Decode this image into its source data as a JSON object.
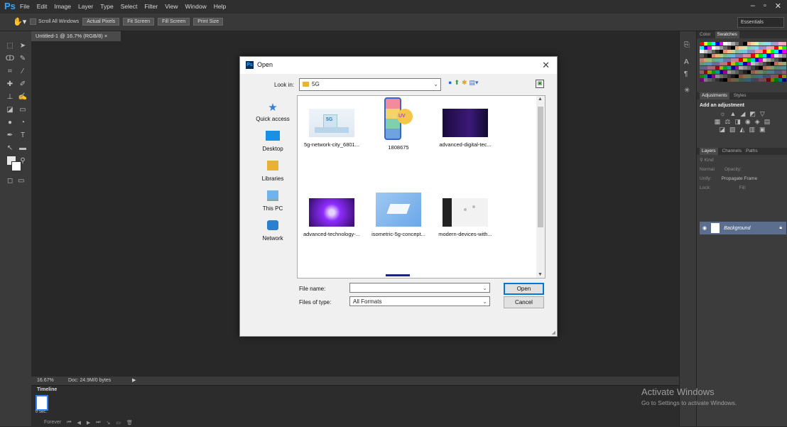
{
  "app": {
    "logo": "Ps",
    "menu": [
      "File",
      "Edit",
      "Image",
      "Layer",
      "Type",
      "Select",
      "Filter",
      "View",
      "Window",
      "Help"
    ],
    "window_controls": [
      "–",
      "▫",
      "✕"
    ]
  },
  "options_bar": {
    "tool_icon": "hand-tool-icon",
    "scroll_all_label": "Scroll All Windows",
    "buttons": [
      "Actual Pixels",
      "Fit Screen",
      "Fill Screen",
      "Print Size"
    ],
    "workspace": "Essentials"
  },
  "document": {
    "tab": "Untitled-1 @ 16.7% (RGB/8)  ×",
    "zoom": "16.67%",
    "doc_info": "Doc: 24.9M/0 bytes"
  },
  "timeline": {
    "title": "Timeline",
    "frame_time": "0 sec.",
    "loop": "Forever"
  },
  "panels": {
    "color_tabs": [
      "Color",
      "Swatches"
    ],
    "adjust_tabs": [
      "Adjustments",
      "Styles"
    ],
    "add_adjustment": "Add an adjustment",
    "layer_tabs": [
      "Layers",
      "Channels",
      "Paths"
    ],
    "kind": "Kind",
    "blend": "Normal",
    "opacity_label": "Opacity:",
    "unify_label": "Unify:",
    "propagate": "Propagate Frame",
    "lock_label": "Lock:",
    "fill_label": "Fill:",
    "layer_name": "Background"
  },
  "activate": {
    "title": "Activate Windows",
    "subtitle": "Go to Settings to activate Windows."
  },
  "dialog": {
    "title": "Open",
    "look_in_label": "Look in:",
    "look_in_value": "5G",
    "places": [
      "Quick access",
      "Desktop",
      "Libraries",
      "This PC",
      "Network"
    ],
    "files": [
      "5g-network-city_6801...",
      "1808675",
      "advanced-digital-tec...",
      "advanced-technology-...",
      "isometric-5g-concept...",
      "modern-devices-with..."
    ],
    "file_name_label": "File name:",
    "file_name_value": "",
    "files_of_type_label": "Files of type:",
    "files_of_type_value": "All Formats",
    "open_button": "Open",
    "cancel_button": "Cancel"
  }
}
